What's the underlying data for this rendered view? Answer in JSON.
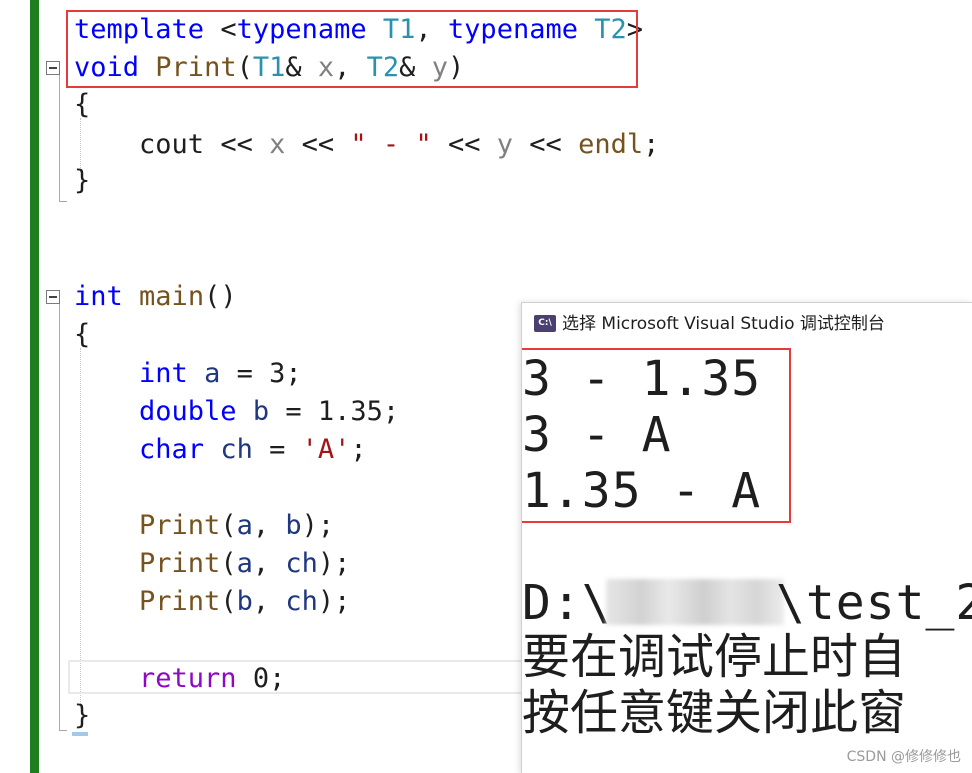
{
  "editor": {
    "code": {
      "template_kw": "template",
      "typename_kw": "typename",
      "t1": "T1",
      "t2": "T2",
      "void_kw": "void",
      "print_fn": "Print",
      "x_param": "x",
      "y_param": "y",
      "open_brace": "{",
      "close_brace": "}",
      "cout": "cout",
      "shift": "<<",
      "dash_string": "\" - \"",
      "endl": "endl",
      "int_kw": "int",
      "main_fn": "main",
      "a_var": "a",
      "b_var": "b",
      "ch_var": "ch",
      "double_kw": "double",
      "char_kw": "char",
      "num_3": "3",
      "num_135": "1.35",
      "char_a": "'A'",
      "return_kw": "return",
      "num_0": "0"
    }
  },
  "console": {
    "title": "选择 Microsoft Visual Studio 调试控制台",
    "icon_text": "C:\\",
    "output_lines": [
      "3 - 1.35",
      "3 - A",
      "1.35 - A"
    ],
    "path_prefix": "D:\\",
    "path_suffix": "\\test_2",
    "message_line1": "要在调试停止时自",
    "message_line2": "按任意键关闭此窗"
  },
  "watermark": "CSDN @修修修也",
  "colors": {
    "keyword": "#0000ff",
    "type": "#2b91af",
    "function": "#74531f",
    "parameter": "#808080",
    "string": "#a31515",
    "return_keyword": "#8f08c4",
    "change_bar": "#1f7f1f",
    "highlight_box": "#e53b3b"
  }
}
